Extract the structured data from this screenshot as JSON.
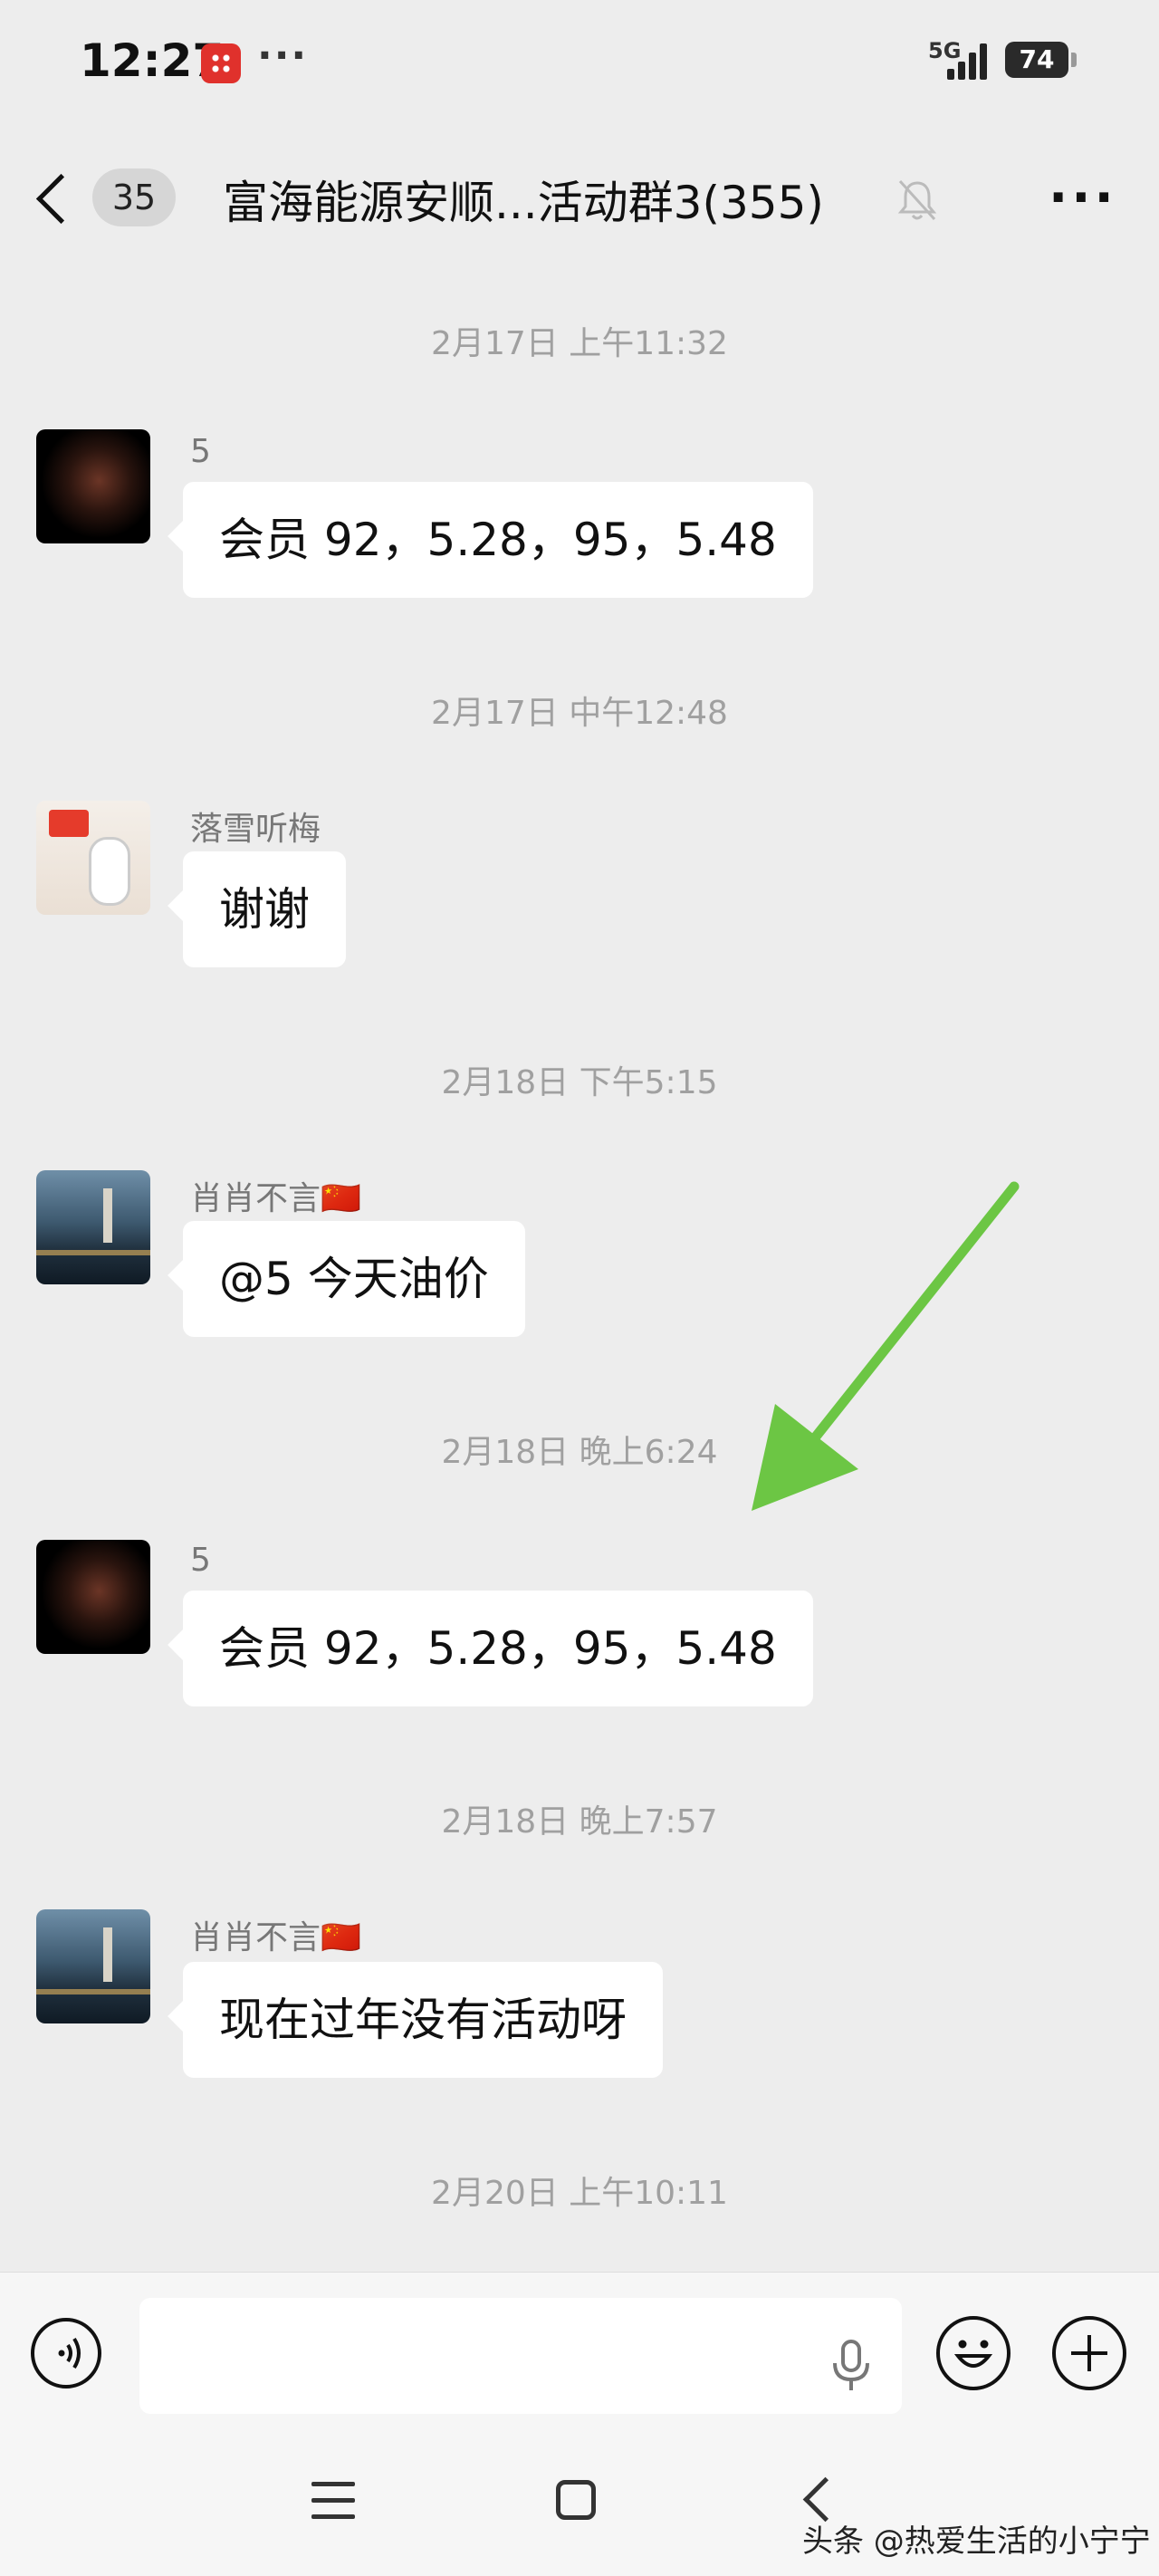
{
  "status_bar": {
    "time": "12:27",
    "more_indicator": "···",
    "network": "5G",
    "battery": "74"
  },
  "header": {
    "unread_count": "35",
    "title": "富海能源安顺...活动群3(355)",
    "more_label": "···"
  },
  "messages": [
    {
      "timestamp": "2月17日 上午11:32",
      "sender": "5",
      "text": "会员 92，5.28，95，5.48"
    },
    {
      "timestamp": "2月17日 中午12:48",
      "sender": "落雪听梅",
      "text": "谢谢"
    },
    {
      "timestamp": "2月18日 下午5:15",
      "sender": "肖肖不言🇨🇳",
      "text": "@5  今天油价"
    },
    {
      "timestamp": "2月18日 晚上6:24",
      "sender": "5",
      "text": "会员 92，5.28，95，5.48"
    },
    {
      "timestamp": "2月18日 晚上7:57",
      "sender": "肖肖不言🇨🇳",
      "text": "现在过年没有活动呀"
    },
    {
      "timestamp": "2月20日 上午10:11"
    }
  ],
  "input_bar": {
    "text_value": ""
  },
  "watermark": "头条 @热爱生活的小宁宁",
  "colors": {
    "background": "#ededed",
    "bubble": "#ffffff",
    "timestamp": "#a0a0a0",
    "annotation_arrow": "#6cc644"
  },
  "icons": [
    "back-icon",
    "mute-bell-icon",
    "more-icon",
    "voice-icon",
    "microphone-icon",
    "emoji-icon",
    "plus-icon",
    "annotation-arrow-icon"
  ]
}
